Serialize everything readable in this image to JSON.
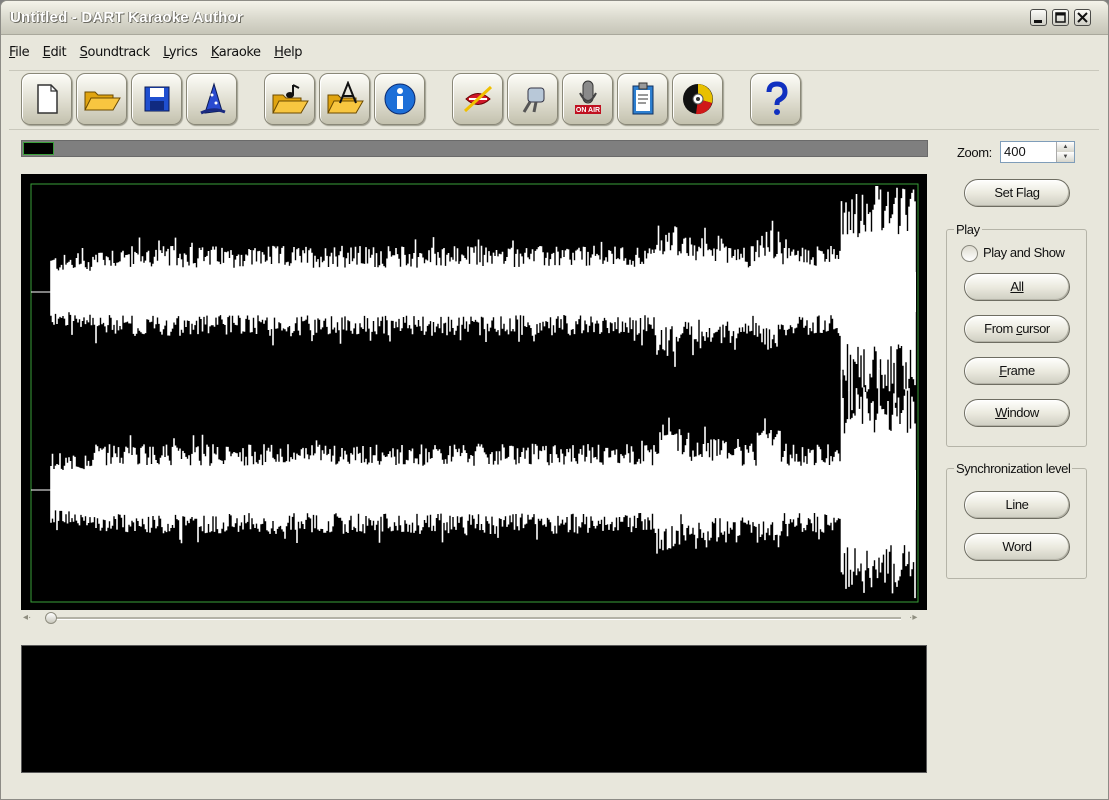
{
  "window": {
    "title": "Untitled - DART Karaoke Author",
    "controls": [
      "minimize",
      "maximize",
      "close"
    ]
  },
  "menubar": {
    "items": [
      "File",
      "Edit",
      "Soundtrack",
      "Lyrics",
      "Karaoke",
      "Help"
    ]
  },
  "toolbar": {
    "buttons": [
      {
        "icon": "new-document-icon"
      },
      {
        "icon": "open-folder-icon"
      },
      {
        "icon": "save-disk-icon"
      },
      {
        "icon": "wizard-hat-icon"
      },
      {
        "icon": "open-soundtrack-icon"
      },
      {
        "icon": "open-lyrics-icon"
      },
      {
        "icon": "info-icon"
      },
      {
        "icon": "mute-vocals-icon"
      },
      {
        "icon": "mixer-icon"
      },
      {
        "icon": "on-air-microphone-icon"
      },
      {
        "icon": "clipboard-icon"
      },
      {
        "icon": "cd-burn-icon"
      },
      {
        "icon": "help-question-icon"
      }
    ]
  },
  "progress": {
    "value": 0.034
  },
  "waveform": {
    "channels": 2,
    "scroll_position": 0.0
  },
  "side": {
    "zoom_label": "Zoom:",
    "zoom_value": "400",
    "set_flag": "Set Flag",
    "play_group": {
      "title": "Play",
      "play_and_show": "Play and Show",
      "all": "All",
      "from_cursor_prefix": "From ",
      "from_cursor_accel": "c",
      "from_cursor_suffix": "ursor",
      "frame_accel": "F",
      "frame_rest": "rame",
      "window_accel": "W",
      "window_rest": "indow"
    },
    "sync_group": {
      "title": "Synchronization level",
      "line": "Line",
      "word": "Word"
    }
  },
  "colors": {
    "window_bg": "#e8e7dc",
    "waveform_bg": "#000000",
    "waveform_fg": "#ffffff",
    "selection_border": "#3aa03a"
  }
}
